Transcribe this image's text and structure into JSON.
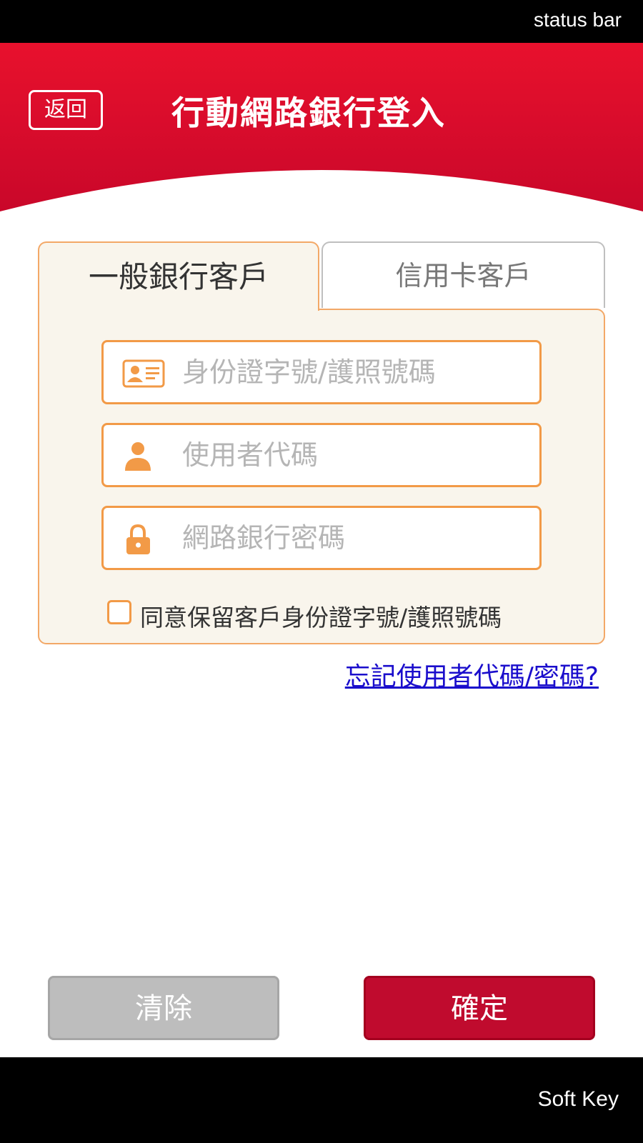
{
  "status_bar": {
    "label": "status bar"
  },
  "header": {
    "back_label": "返回",
    "title": "行動網路銀行登入",
    "color_top": "#e8112d",
    "color_bottom": "#c9072a"
  },
  "tabs": [
    {
      "label": "一般銀行客戶",
      "active": true
    },
    {
      "label": "信用卡客戶",
      "active": false
    }
  ],
  "form": {
    "id_field": {
      "placeholder": "身份證字號/護照號碼",
      "value": "",
      "icon": "id-card-icon"
    },
    "user_field": {
      "placeholder": "使用者代碼",
      "value": "",
      "icon": "user-icon"
    },
    "password_field": {
      "placeholder": "網路銀行密碼",
      "value": "",
      "icon": "lock-icon"
    },
    "remember": {
      "label": "同意保留客戶身份證字號/護照號碼",
      "checked": false
    }
  },
  "forgot_link": "忘記使用者代碼/密碼?",
  "buttons": {
    "clear": "清除",
    "confirm": "確定"
  },
  "soft_key": {
    "label": "Soft Key"
  },
  "colors": {
    "accent_orange": "#f29a47",
    "card_bg": "#f9f5ec",
    "confirm_red": "#c00b2e",
    "link_blue": "#1a0dcc"
  }
}
